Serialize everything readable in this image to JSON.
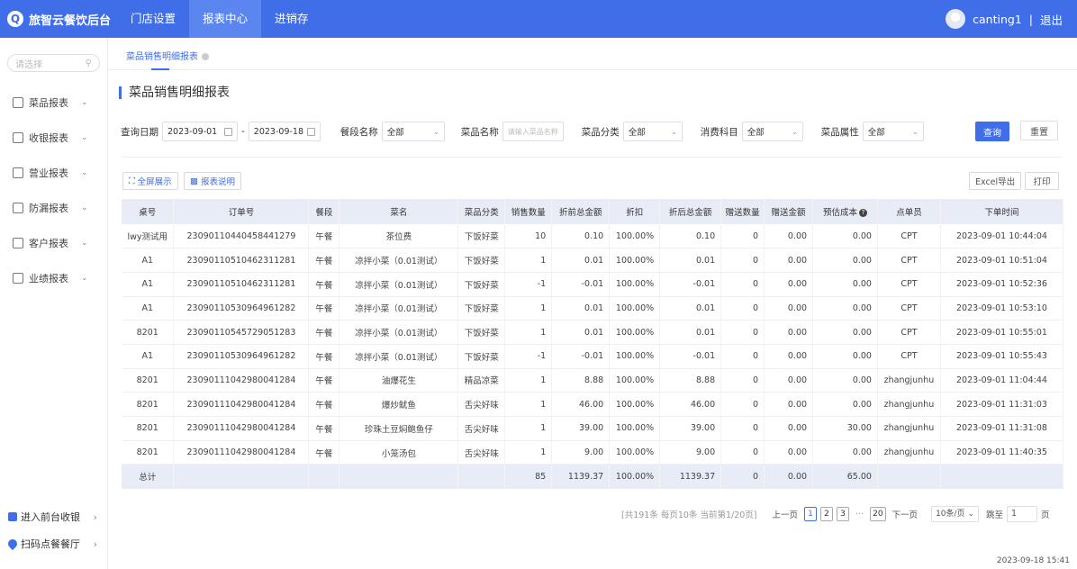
{
  "app": {
    "logo_text": "旅智云餐饮后台"
  },
  "topnav": [
    {
      "label": "门店设置"
    },
    {
      "label": "报表中心"
    },
    {
      "label": "进销存"
    }
  ],
  "user": {
    "name": "canting1",
    "separator": "|",
    "logout": "退出"
  },
  "sidebar": {
    "search_placeholder": "请选择",
    "items": [
      {
        "label": "菜品报表"
      },
      {
        "label": "收银报表"
      },
      {
        "label": "营业报表"
      },
      {
        "label": "防漏报表"
      },
      {
        "label": "客户报表"
      },
      {
        "label": "业绩报表"
      }
    ],
    "bottom": [
      {
        "label": "进入前台收银"
      },
      {
        "label": "扫码点餐餐厅"
      }
    ]
  },
  "tab": {
    "label": "菜品销售明细报表"
  },
  "page": {
    "title": "菜品销售明细报表"
  },
  "filters": {
    "date_label": "查询日期",
    "date_start": "2023-09-01",
    "date_sep": "-",
    "date_end": "2023-09-18",
    "segment_label": "餐段名称",
    "segment_value": "全部",
    "dish_label": "菜品名称",
    "dish_placeholder": "请输入菜品名称",
    "category_label": "菜品分类",
    "category_value": "全部",
    "subject_label": "消费科目",
    "subject_value": "全部",
    "attr_label": "菜品属性",
    "attr_value": "全部",
    "query": "查询",
    "reset": "重置"
  },
  "toolbar": {
    "fullscreen": "全屏展示",
    "explain": "报表说明",
    "excel": "Excel导出",
    "print": "打印"
  },
  "table": {
    "headers": [
      "桌号",
      "订单号",
      "餐段",
      "菜名",
      "菜品分类",
      "销售数量",
      "折前总金额",
      "折扣",
      "折后总金额",
      "赠送数量",
      "赠送金额",
      "预估成本",
      "点单员",
      "下单时间"
    ],
    "rows": [
      [
        "lwy测试用",
        "230901104404584412​79",
        "午餐",
        "茶位费",
        "下饭好菜",
        "10",
        "0.10",
        "100.00%",
        "0.10",
        "0",
        "0.00",
        "0.00",
        "CPT",
        "2023-09-01 10:44:04"
      ],
      [
        "A1",
        "23090110510462311281",
        "午餐",
        "凉拌小菜（0.01测试）",
        "下饭好菜",
        "1",
        "0.01",
        "100.00%",
        "0.01",
        "0",
        "0.00",
        "0.00",
        "CPT",
        "2023-09-01 10:51:04"
      ],
      [
        "A1",
        "23090110510462311281",
        "午餐",
        "凉拌小菜（0.01测试）",
        "下饭好菜",
        "-1",
        "-0.01",
        "100.00%",
        "-0.01",
        "0",
        "0.00",
        "0.00",
        "CPT",
        "2023-09-01 10:52:36"
      ],
      [
        "A1",
        "23090110530964961282",
        "午餐",
        "凉拌小菜（0.01测试）",
        "下饭好菜",
        "1",
        "0.01",
        "100.00%",
        "0.01",
        "0",
        "0.00",
        "0.00",
        "CPT",
        "2023-09-01 10:53:10"
      ],
      [
        "8201",
        "23090110545729051283",
        "午餐",
        "凉拌小菜（0.01测试）",
        "下饭好菜",
        "1",
        "0.01",
        "100.00%",
        "0.01",
        "0",
        "0.00",
        "0.00",
        "CPT",
        "2023-09-01 10:55:01"
      ],
      [
        "A1",
        "23090110530964961282",
        "午餐",
        "凉拌小菜（0.01测试）",
        "下饭好菜",
        "-1",
        "-0.01",
        "100.00%",
        "-0.01",
        "0",
        "0.00",
        "0.00",
        "CPT",
        "2023-09-01 10:55:43"
      ],
      [
        "8201",
        "23090111042980041284",
        "午餐",
        "油爆花生",
        "精品凉菜",
        "1",
        "8.88",
        "100.00%",
        "8.88",
        "0",
        "0.00",
        "0.00",
        "zhangjunhu",
        "2023-09-01 11:04:44"
      ],
      [
        "8201",
        "23090111042980041284",
        "午餐",
        "爆炒鱿鱼",
        "舌尖好味",
        "1",
        "46.00",
        "100.00%",
        "46.00",
        "0",
        "0.00",
        "0.00",
        "zhangjunhu",
        "2023-09-01 11:31:03"
      ],
      [
        "8201",
        "23090111042980041284",
        "午餐",
        "珍珠土豆焖鲍鱼仔",
        "舌尖好味",
        "1",
        "39.00",
        "100.00%",
        "39.00",
        "0",
        "0.00",
        "30.00",
        "zhangjunhu",
        "2023-09-01 11:31:08"
      ],
      [
        "8201",
        "23090111042980041284",
        "午餐",
        "小笼汤包",
        "舌尖好味",
        "1",
        "9.00",
        "100.00%",
        "9.00",
        "0",
        "0.00",
        "0.00",
        "zhangjunhu",
        "2023-09-01 11:40:35"
      ]
    ],
    "total": {
      "label": "总计",
      "qty": "85",
      "pre": "1139.37",
      "disc": "100.00%",
      "post": "1139.37",
      "gift_qty": "0",
      "gift_amt": "0.00",
      "cost": "65.00"
    }
  },
  "pager": {
    "info": "[共191条 每页10条 当前第1/20页]",
    "prev": "上一页",
    "pages": [
      "1",
      "2",
      "3"
    ],
    "ellipsis": "···",
    "last": "20",
    "next": "下一页",
    "size": "10条/页",
    "jump_label": "跳至",
    "jump_value": "1",
    "page_unit": "页"
  },
  "footer": {
    "time": "2023-09-18 15:41"
  },
  "colors": {
    "primary": "#3f6ee8",
    "header_bg": "#e8ecf7"
  }
}
